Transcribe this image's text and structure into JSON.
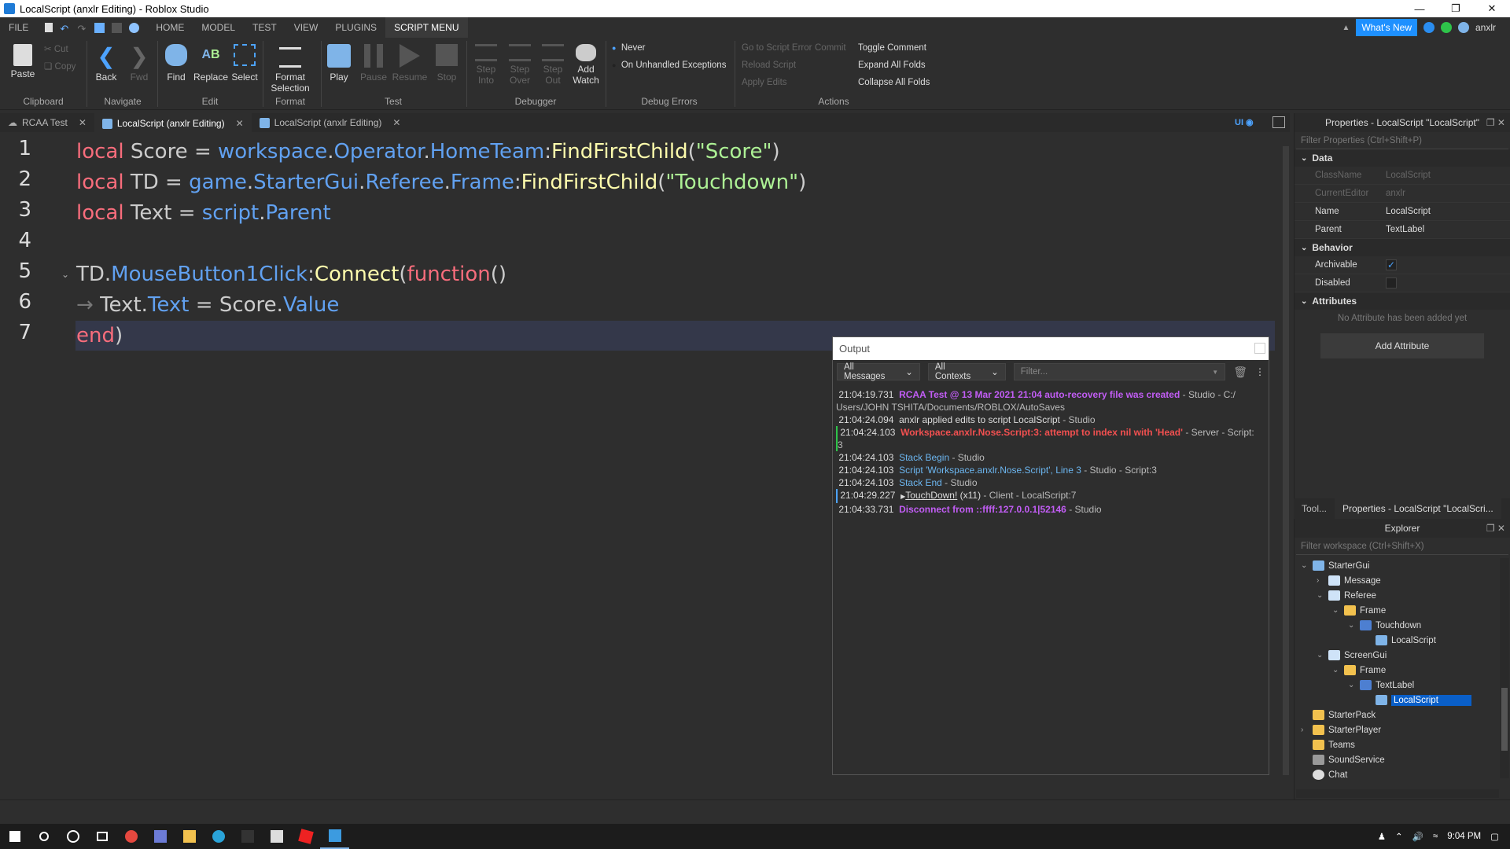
{
  "window": {
    "title": "LocalScript (anxlr Editing) - Roblox Studio"
  },
  "ribbon_tabs": [
    "FILE",
    "HOME",
    "MODEL",
    "TEST",
    "VIEW",
    "PLUGINS",
    "SCRIPT MENU"
  ],
  "ribbon_right": {
    "whats_new": "What's New",
    "user": "anxlr"
  },
  "ribbon": {
    "clipboard": {
      "paste": "Paste",
      "cut": "Cut",
      "copy": "Copy",
      "group": "Clipboard"
    },
    "navigate": {
      "back": "Back",
      "fwd": "Fwd",
      "group": "Navigate"
    },
    "edit": {
      "find": "Find",
      "replace": "Replace",
      "select": "Select",
      "group": "Edit"
    },
    "format": {
      "format_selection": "Format Selection",
      "group": "Format"
    },
    "test": {
      "play": "Play",
      "pause": "Pause",
      "resume": "Resume",
      "stop": "Stop",
      "group": "Test"
    },
    "debugger": {
      "step_into": "Step Into",
      "step_over": "Step Over",
      "step_out": "Step Out",
      "add_watch": "Add Watch",
      "group": "Debugger"
    },
    "debug_errors": {
      "never": "Never",
      "on_unhandled": "On Unhandled Exceptions",
      "group": "Debug Errors"
    },
    "actions": {
      "go_to_script_error": "Go to Script Error",
      "commit": "Commit",
      "reload_script": "Reload Script",
      "apply_edits": "Apply Edits",
      "toggle_comment": "Toggle Comment",
      "expand_all_folds": "Expand All Folds",
      "collapse_all_folds": "Collapse All Folds",
      "group": "Actions"
    }
  },
  "doc_tabs": [
    {
      "label": "RCAA Test"
    },
    {
      "label": "LocalScript (anxlr Editing)"
    },
    {
      "label": "LocalScript (anxlr Editing)"
    }
  ],
  "editor": {
    "line_numbers": [
      "1",
      "2",
      "3",
      "4",
      "5",
      "6",
      "7"
    ],
    "code": {
      "l1": {
        "local": "local",
        "name": " Score = ",
        "ws": "workspace",
        "d1": ".",
        "op": "Operator",
        "d2": ".",
        "ht": "HomeTeam",
        "c": ":",
        "fn": "FindFirstChild",
        "o": "(",
        "str": "\"Score\"",
        "cl": ")"
      },
      "l2": {
        "local": "local",
        "name": " TD = ",
        "game": "game",
        "d1": ".",
        "sg": "StarterGui",
        "d2": ".",
        "ref": "Referee",
        "d3": ".",
        "fr": "Frame",
        "c": ":",
        "fn": "FindFirstChild",
        "o": "(",
        "str": "\"Touchdown\"",
        "cl": ")"
      },
      "l3": {
        "local": "local",
        "name": " Text = ",
        "scr": "script",
        "d1": ".",
        "par": "Parent"
      },
      "l5": {
        "td": "TD",
        "d1": ".",
        "ev": "MouseButton1Click",
        "c": ":",
        "fn": "Connect",
        "o": "(",
        "kw": "function",
        "cl": "()"
      },
      "l6": {
        "arrow": "→ ",
        "txt": "Text",
        "d1": ".",
        "prop": "Text",
        "eq": " = ",
        "score": "Score",
        "d2": ".",
        "val": "Value"
      },
      "l7": {
        "kw": "end",
        "cl": ")"
      }
    }
  },
  "output": {
    "title": "Output",
    "filter_messages": "All Messages",
    "filter_contexts": "All Contexts",
    "filter_placeholder": "Filter...",
    "lines": [
      {
        "time": "21:04:19.731",
        "msg": "RCAA Test @ 13 Mar 2021 21:04 auto-recovery file was created",
        "src": " - Studio - C:/",
        "cont": "Users/JOHN TSHITA/Documents/ROBLOX/AutoSaves"
      },
      {
        "time": "21:04:24.094",
        "msg": "anxlr applied edits to script LocalScript",
        "src": " - Studio"
      },
      {
        "time": "21:04:24.103",
        "msg": "Workspace.anxlr.Nose.Script:3: attempt to index nil with 'Head'",
        "src": " - Server - Script:",
        "cont": "3"
      },
      {
        "time": "21:04:24.103",
        "msg": "Stack Begin",
        "src": " - Studio"
      },
      {
        "time": "21:04:24.103",
        "msg": "Script 'Workspace.anxlr.Nose.Script', Line 3",
        "src": " - Studio - Script:3"
      },
      {
        "time": "21:04:24.103",
        "msg": "Stack End",
        "src": " - Studio"
      },
      {
        "time": "21:04:29.227",
        "msg": "TouchDown!",
        "count": " (x11)",
        "src": " - Client - LocalScript:7"
      },
      {
        "time": "21:04:33.731",
        "msg": "Disconnect from ::ffff:127.0.0.1|52146",
        "src": " - Studio"
      }
    ]
  },
  "properties": {
    "title": "Properties - LocalScript \"LocalScript\"",
    "filter": "Filter Properties (Ctrl+Shift+P)",
    "sections": {
      "data": "Data",
      "behavior": "Behavior",
      "attributes": "Attributes"
    },
    "rows": {
      "classname": {
        "k": "ClassName",
        "v": "LocalScript"
      },
      "currenteditor": {
        "k": "CurrentEditor",
        "v": "anxlr"
      },
      "name": {
        "k": "Name",
        "v": "LocalScript"
      },
      "parent": {
        "k": "Parent",
        "v": "TextLabel"
      },
      "archivable": {
        "k": "Archivable"
      },
      "disabled": {
        "k": "Disabled"
      }
    },
    "no_attribute": "No Attribute has been added yet",
    "add_attribute": "Add Attribute",
    "bottom_tabs": [
      "Tool...",
      "Properties - LocalScript \"LocalScri..."
    ]
  },
  "explorer": {
    "title": "Explorer",
    "filter": "Filter workspace (Ctrl+Shift+X)",
    "items": [
      {
        "label": "StarterGui"
      },
      {
        "label": "Message"
      },
      {
        "label": "Referee"
      },
      {
        "label": "Frame"
      },
      {
        "label": "Touchdown"
      },
      {
        "label": "LocalScript"
      },
      {
        "label": "ScreenGui"
      },
      {
        "label": "Frame"
      },
      {
        "label": "TextLabel"
      },
      {
        "label": "LocalScript"
      },
      {
        "label": "StarterPack"
      },
      {
        "label": "StarterPlayer"
      },
      {
        "label": "Teams"
      },
      {
        "label": "SoundService"
      },
      {
        "label": "Chat"
      }
    ]
  },
  "taskbar": {
    "time": "9:04 PM"
  }
}
